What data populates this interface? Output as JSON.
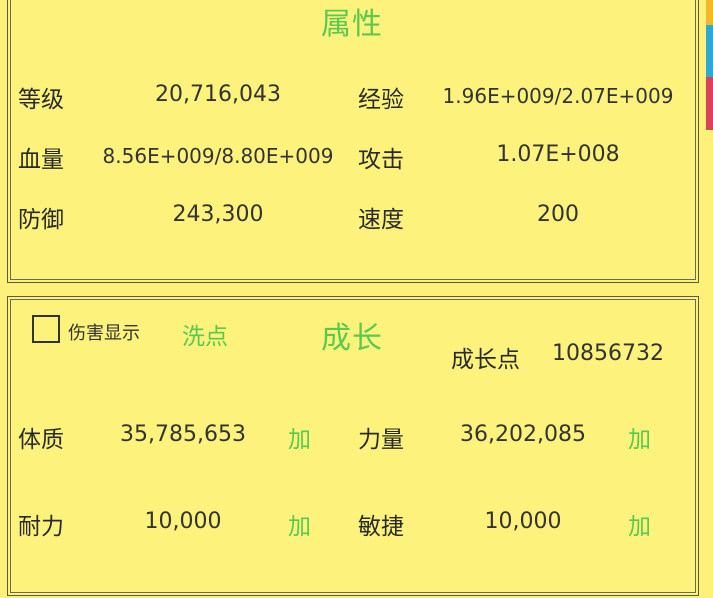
{
  "attributes": {
    "title": "属性",
    "level_label": "等级",
    "level_value": "20,716,043",
    "exp_label": "经验",
    "exp_value": "1.96E+009/2.07E+009",
    "hp_label": "血量",
    "hp_value": "8.56E+009/8.80E+009",
    "attack_label": "攻击",
    "attack_value": "1.07E+008",
    "defense_label": "防御",
    "defense_value": "243,300",
    "speed_label": "速度",
    "speed_value": "200"
  },
  "growth": {
    "title": "成长",
    "damage_display_label": "伤害显示",
    "damage_display_checked": false,
    "reset_label": "洗点",
    "points_label": "成长点",
    "points_value": "10856732",
    "constitution_label": "体质",
    "constitution_value": "35,785,653",
    "strength_label": "力量",
    "strength_value": "36,202,085",
    "endurance_label": "耐力",
    "endurance_value": "10,000",
    "agility_label": "敏捷",
    "agility_value": "10,000",
    "add_label": "加"
  },
  "colors": {
    "background": "#fdf17a",
    "accent_green": "#59c94f",
    "strip_yellow": "#f3b92c",
    "strip_blue": "#2fa8d6",
    "strip_red": "#d9435a"
  }
}
